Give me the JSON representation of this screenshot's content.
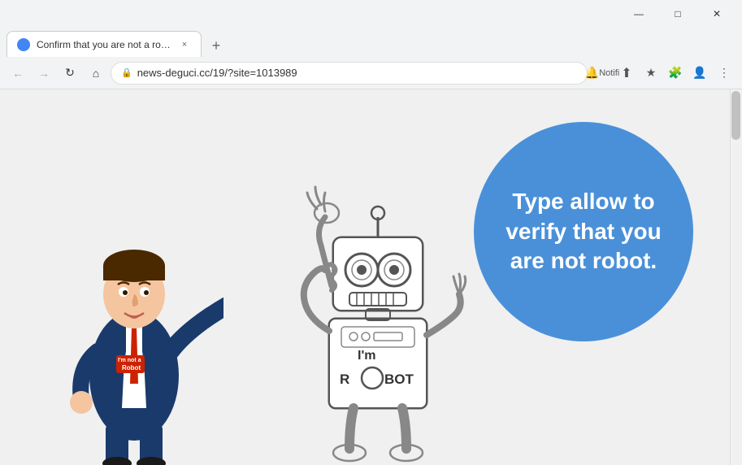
{
  "browser": {
    "tab": {
      "title": "Confirm that you are not a robot",
      "favicon": "🤖",
      "close_label": "×"
    },
    "new_tab_label": "+",
    "nav": {
      "back_label": "←",
      "forward_label": "→",
      "reload_label": "↻",
      "home_label": "⌂",
      "url": "news-deguci.cc/19/?site=1013989",
      "lock_icon": "🔒",
      "notifications_label": "Notifi",
      "share_label": "↑",
      "bookmark_label": "★",
      "extensions_label": "🧩",
      "profile_label": "👤",
      "menu_label": "⋮"
    },
    "window_controls": {
      "minimize": "—",
      "maximize": "□",
      "close": "✕"
    }
  },
  "page": {
    "background_color": "#f0f0f0",
    "circle": {
      "color": "#4a90d9",
      "text": "Type allow to verify that you are not robot."
    }
  }
}
